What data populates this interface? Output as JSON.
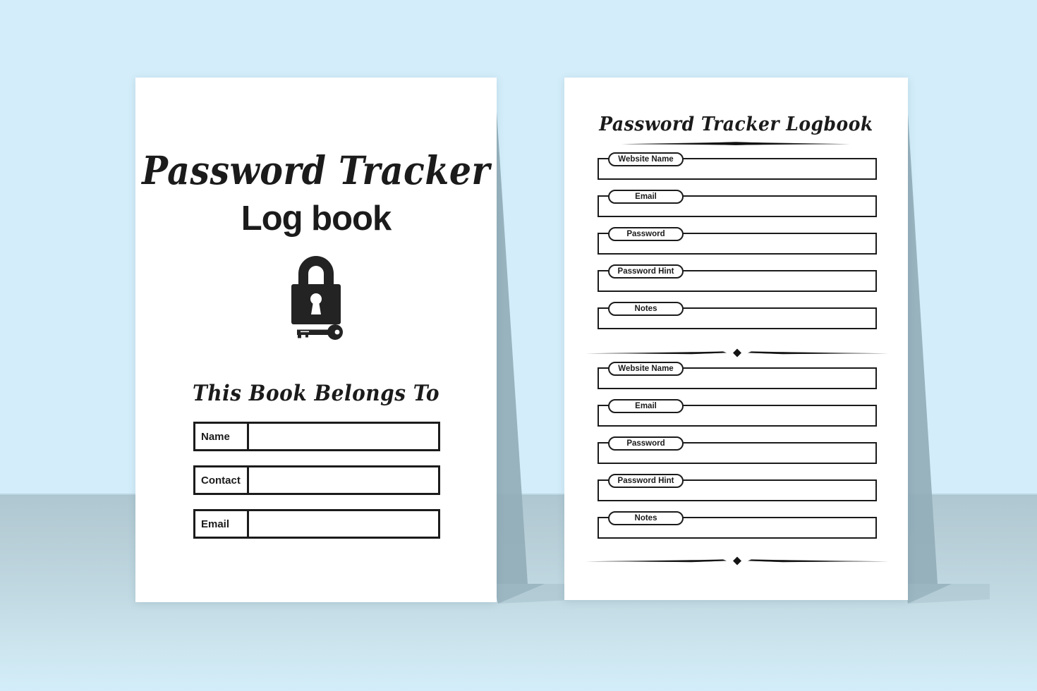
{
  "scene": {
    "background_wall_color": "#d3edfa",
    "background_floor_color": "#b8d0da",
    "shadow_color": "#8fa9b5",
    "ink_color": "#1b1b1b",
    "page_color": "#ffffff"
  },
  "cover": {
    "title": "Password Tracker",
    "subtitle": "Log book",
    "lock_icon": "padlock-with-key-icon",
    "belongs_heading": "This Book Belongs To",
    "owner_fields": [
      {
        "label": "Name",
        "value": ""
      },
      {
        "label": "Contact",
        "value": ""
      },
      {
        "label": "Email",
        "value": ""
      }
    ]
  },
  "interior": {
    "title": "Password Tracker Logbook",
    "divider_ornament": "diamond-rule-divider",
    "entries": [
      {
        "fields": [
          {
            "label": "Website Name",
            "value": ""
          },
          {
            "label": "Email",
            "value": ""
          },
          {
            "label": "Password",
            "value": ""
          },
          {
            "label": "Password Hint",
            "value": ""
          },
          {
            "label": "Notes",
            "value": ""
          }
        ]
      },
      {
        "fields": [
          {
            "label": "Website Name",
            "value": ""
          },
          {
            "label": "Email",
            "value": ""
          },
          {
            "label": "Password",
            "value": ""
          },
          {
            "label": "Password Hint",
            "value": ""
          },
          {
            "label": "Notes",
            "value": ""
          }
        ]
      }
    ]
  }
}
